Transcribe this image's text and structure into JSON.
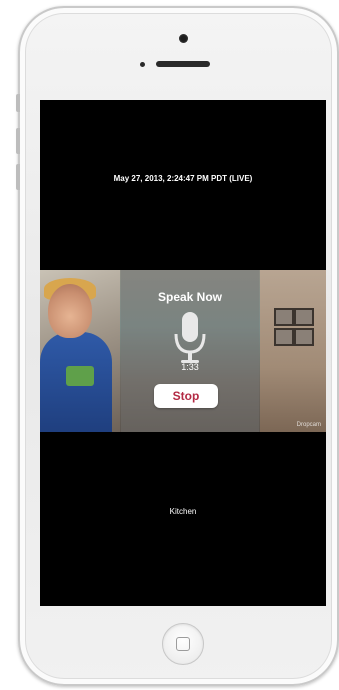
{
  "screen": {
    "timestamp": "May 27, 2013, 2:24:47 PM PDT (LIVE)",
    "camera_name": "Kitchen"
  },
  "voice": {
    "title": "Speak Now",
    "timer": "1:33",
    "stop_label": "Stop",
    "icon": "microphone-icon"
  },
  "video": {
    "watermark": "Dropcam"
  },
  "device": {
    "home_icon": "home-button-icon"
  },
  "colors": {
    "stop_text": "#b32a44",
    "screen_bg": "#000000",
    "phone_body": "#eeeeee"
  }
}
